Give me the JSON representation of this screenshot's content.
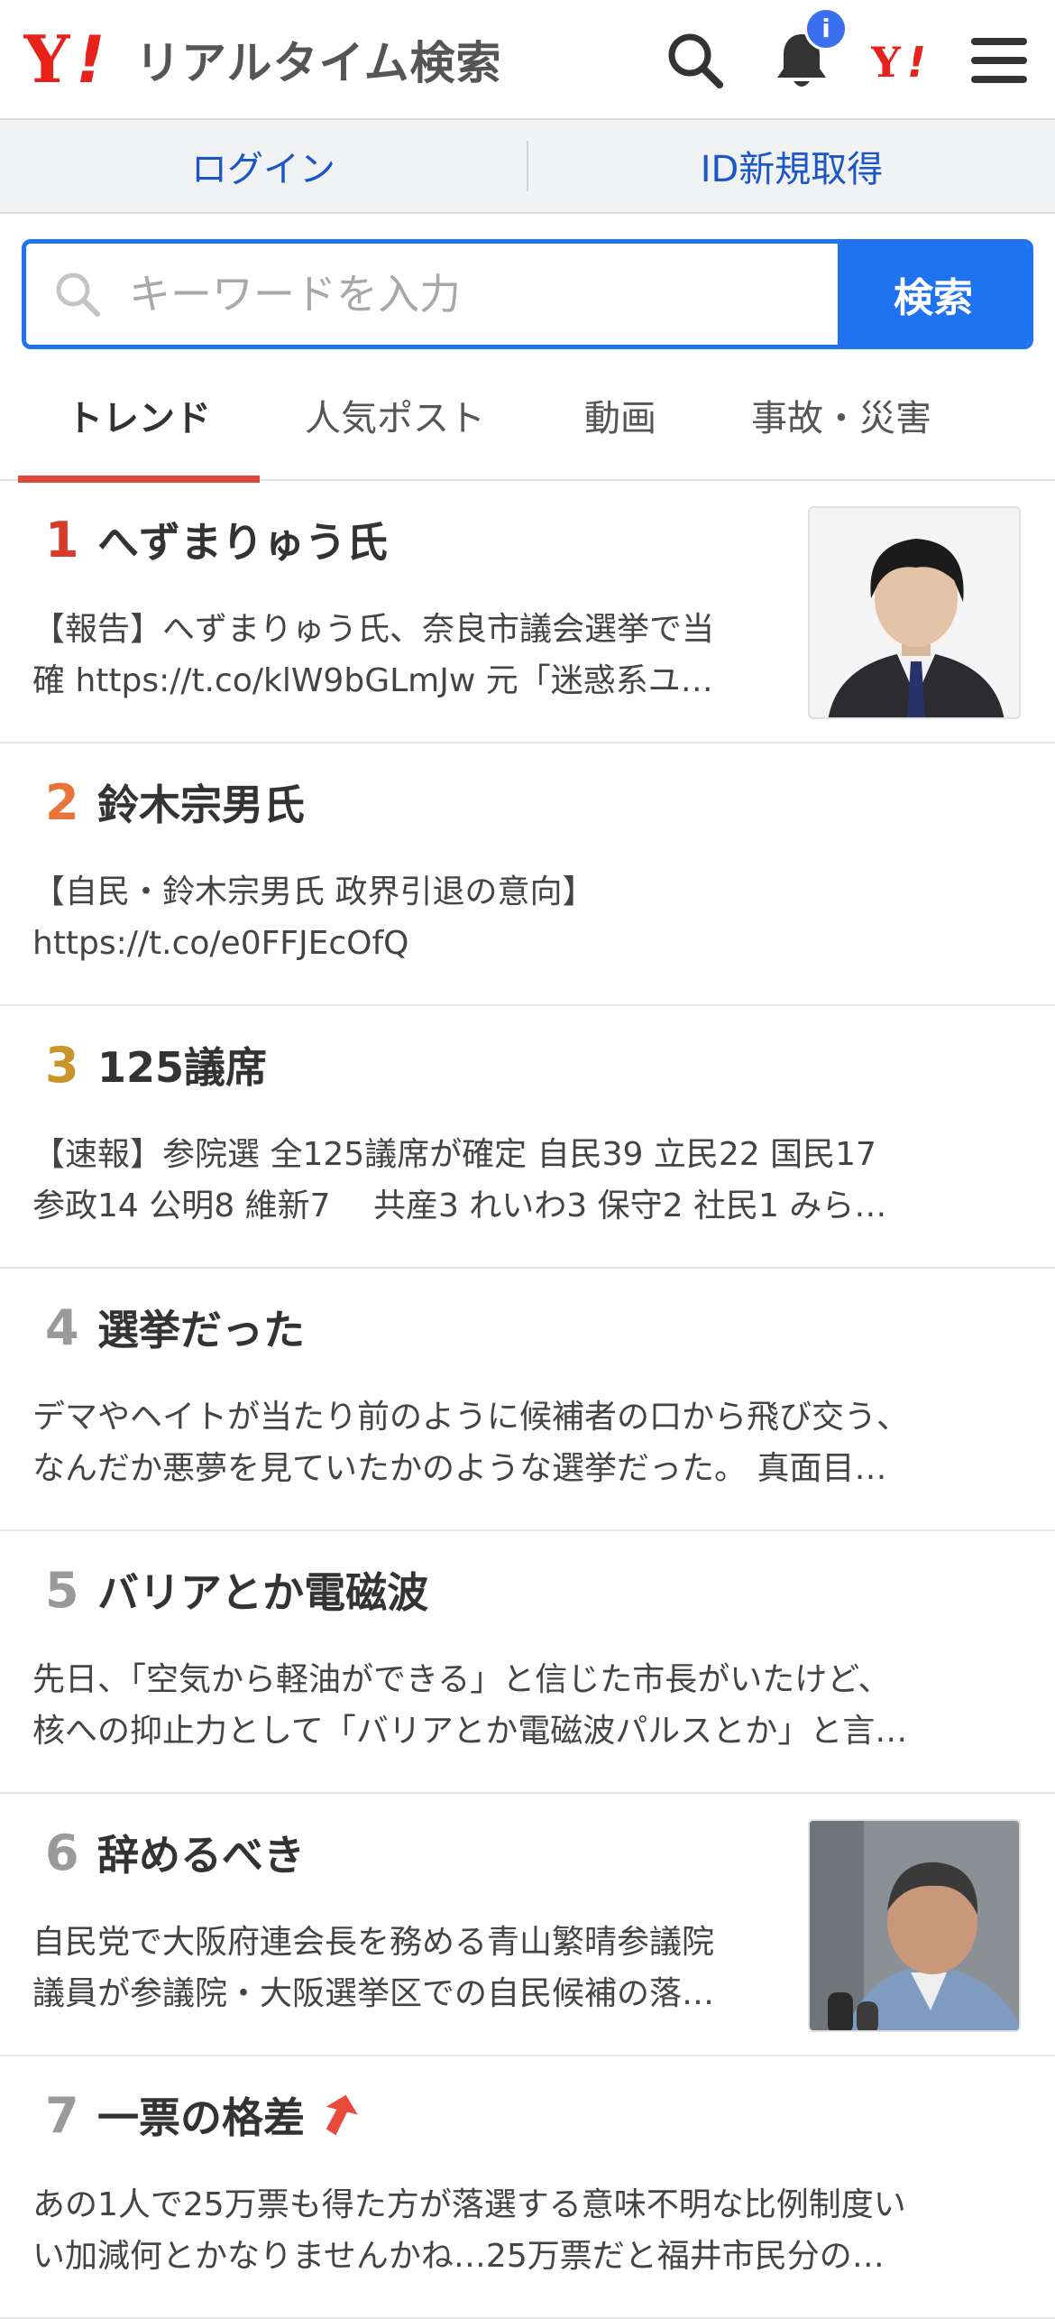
{
  "header": {
    "logo_text": "リアルタイム検索",
    "notification_badge": "i"
  },
  "loginbar": {
    "login_label": "ログイン",
    "register_label": "ID新規取得"
  },
  "search": {
    "placeholder": "キーワードを入力",
    "button_label": "検索"
  },
  "tabs": [
    {
      "label": "トレンド",
      "active": true
    },
    {
      "label": "人気ポスト",
      "active": false
    },
    {
      "label": "動画",
      "active": false
    },
    {
      "label": "事故・災害",
      "active": false
    }
  ],
  "colors": {
    "accent": "#1f72f0",
    "tab_underline": "#e0483b",
    "rank1": "#d93b2b",
    "rank2": "#e8743a",
    "rank3": "#c9952b",
    "rank_other": "#9a9a9a"
  },
  "trends": [
    {
      "rank": "1",
      "title": "へずまりゅう氏",
      "line1": "【報告】へずまりゅう氏、奈良市議会選挙で当",
      "line2": "確 https://t.co/klW9bGLmJw 元「迷惑系ユ…",
      "thumb": "man-portrait"
    },
    {
      "rank": "2",
      "title": "鈴木宗男氏",
      "line1": "【自民・鈴木宗男氏 政界引退の意向】",
      "line2": "https://t.co/e0FFJEcOfQ"
    },
    {
      "rank": "3",
      "title": "125議席",
      "line1": "【速報】参院選 全125議席が確定 自民39 立民22 国民17",
      "line2": "参政14 公明8 維新7 　共産3 れいわ3 保守2 社民1 みら…"
    },
    {
      "rank": "4",
      "title": "選挙だった",
      "line1": "デマやヘイトが当たり前のように候補者の口から飛び交う、",
      "line2": "なんだか悪夢を見ていたかのような選挙だった。 真面目…"
    },
    {
      "rank": "5",
      "title": "バリアとか電磁波",
      "line1": "先日、「空気から軽油ができる」と信じた市長がいたけど、",
      "line2": "核への抑止力として「バリアとか電磁波パルスとか」と言…"
    },
    {
      "rank": "6",
      "title": "辞めるべき",
      "line1": "自民党で大阪府連会長を務める青山繁晴参議院",
      "line2": "議員が参議院・大阪選挙区での自民候補の落…",
      "thumb": "politician-photo"
    },
    {
      "rank": "7",
      "title": "一票の格差",
      "line1": "あの1人で25万票も得た方が落選する意味不明な比例制度い",
      "line2": "い加減何とかなりませんかね…25万票だと福井市民分の…",
      "rising": true
    }
  ]
}
